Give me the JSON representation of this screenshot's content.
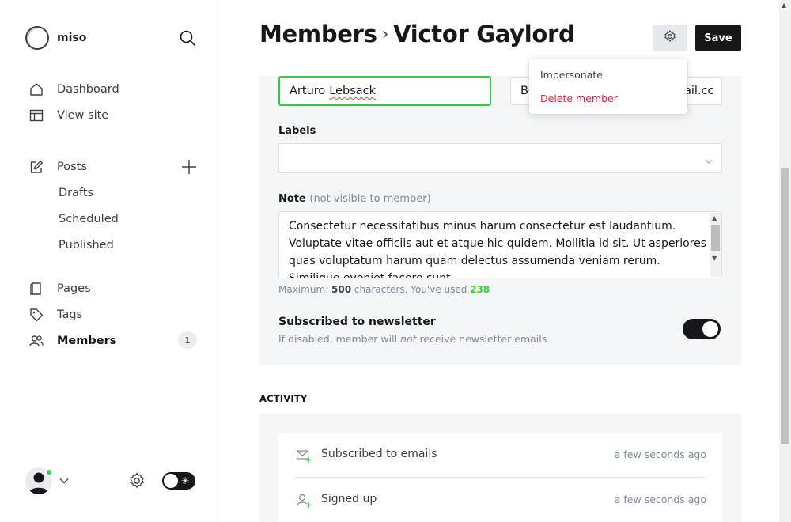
{
  "app": {
    "name": "miso"
  },
  "sidebar": {
    "nav": [
      {
        "label": "Dashboard",
        "icon": "house-icon"
      },
      {
        "label": "View site",
        "icon": "layout-icon"
      }
    ],
    "posts": {
      "label": "Posts",
      "icon": "pencil-square-icon"
    },
    "post_sub": [
      "Drafts",
      "Scheduled",
      "Published"
    ],
    "more": [
      {
        "label": "Pages",
        "icon": "page-icon"
      },
      {
        "label": "Tags",
        "icon": "tag-icon"
      },
      {
        "label": "Members",
        "icon": "members-icon",
        "count": "1"
      }
    ]
  },
  "header": {
    "section": "Members",
    "separator": "›",
    "name": "Victor Gaylord",
    "save_label": "Save"
  },
  "dropdown": {
    "impersonate": "Impersonate",
    "delete": "Delete member"
  },
  "form": {
    "name_first": "Arturo",
    "name_last": "Lebsack",
    "email_start": "Be",
    "email_end": "ail.cc",
    "labels_label": "Labels",
    "note_label": "Note",
    "note_hint": "(not visible to member)",
    "note_text": "Consectetur necessitatibus minus harum consectetur est laudantium. Voluptate vitae officiis aut et atque hic quidem. Mollitia id sit. Ut asperiores quas voluptatum harum quam delectus assumenda veniam rerum. Similique eveniet facere sunt.",
    "count_prefix": "Maximum:",
    "count_max": "500",
    "count_mid": "characters. You've used",
    "count_used": "238",
    "newsletter_title": "Subscribed to newsletter",
    "newsletter_desc_pre": "If disabled, member will",
    "newsletter_desc_em": "not",
    "newsletter_desc_post": "receive newsletter emails",
    "newsletter_on": true
  },
  "activity": {
    "heading": "ACTIVITY",
    "items": [
      {
        "text": "Subscribed to emails",
        "time": "a few seconds ago",
        "icon": "mail-plus-icon"
      },
      {
        "text": "Signed up",
        "time": "a few seconds ago",
        "icon": "user-plus-icon"
      }
    ]
  },
  "colors": {
    "accent_green": "#30cf43",
    "danger_red": "#e2263f",
    "dark": "#15171a"
  }
}
